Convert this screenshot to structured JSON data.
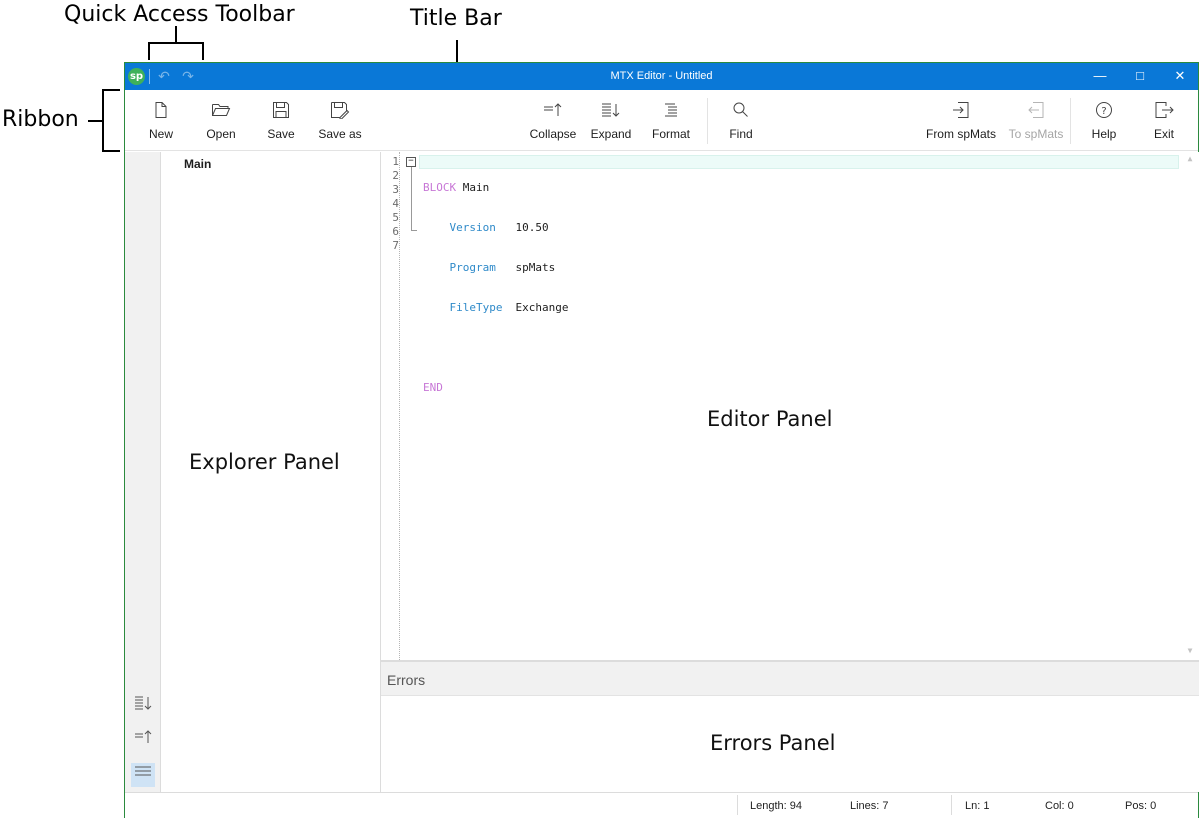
{
  "annotations": {
    "quick_access_toolbar": "Quick Access Toolbar",
    "title_bar": "Title Bar",
    "ribbon": "Ribbon",
    "explorer_panel": "Explorer Panel",
    "editor_panel": "Editor Panel",
    "errors_panel": "Errors Panel"
  },
  "window": {
    "title": "MTX Editor - Untitled",
    "logo_text": "sp",
    "accent_color": "#0a78d7"
  },
  "quick_access": {
    "undo_icon": "undo-icon",
    "redo_icon": "redo-icon"
  },
  "ribbon": {
    "new": "New",
    "open": "Open",
    "save": "Save",
    "save_as": "Save as",
    "collapse": "Collapse",
    "expand": "Expand",
    "format": "Format",
    "find": "Find",
    "from_spmats": "From spMats",
    "to_spmats": "To spMats",
    "help": "Help",
    "exit": "Exit"
  },
  "explorer": {
    "root": "Main"
  },
  "editor": {
    "line_numbers": [
      "1",
      "2",
      "3",
      "4",
      "5",
      "6",
      "7"
    ],
    "lines": [
      {
        "kw": "BLOCK",
        "name": "Main"
      },
      {
        "prop": "Version",
        "value": "10.50"
      },
      {
        "prop": "Program",
        "value": "spMats"
      },
      {
        "prop": "FileType",
        "value": "Exchange"
      },
      {},
      {
        "kw": "END"
      },
      {}
    ]
  },
  "errors": {
    "title": "Errors"
  },
  "status": {
    "length": "Length: 94",
    "lines": "Lines: 7",
    "ln": "Ln: 1",
    "col": "Col: 0",
    "pos": "Pos: 0"
  }
}
